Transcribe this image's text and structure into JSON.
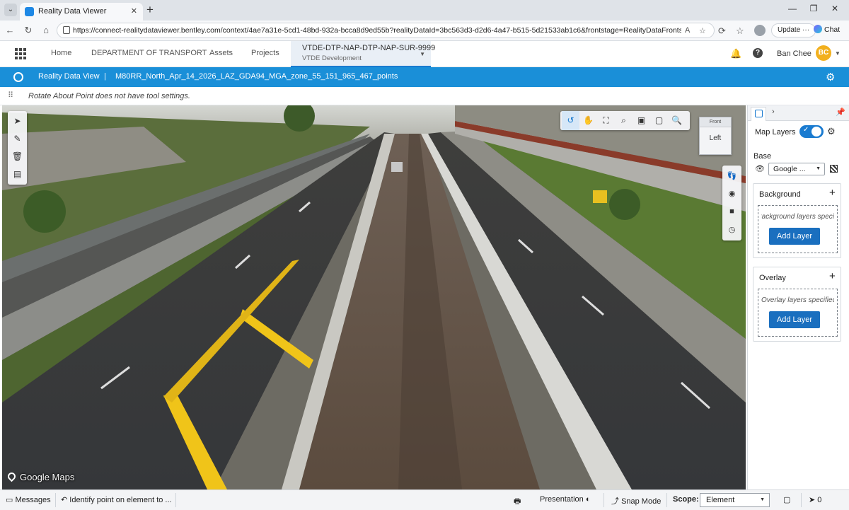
{
  "browser": {
    "tab_title": "Reality Data Viewer",
    "tab_close": "✕",
    "new_tab": "+",
    "url": "https://connect-realitydataviewer.bentley.com/context/4ae7a31e-5cd1-48bd-932a-bcca8d9ed55b?realityDataId=3bc563d3-d2d6-4a47-b515-5d21533ab1c6&frontstage=RealityDataFrontstage",
    "update_label": "Update",
    "chat_label": "Chat"
  },
  "app_header": {
    "nav": [
      "Home",
      "DEPARTMENT OF TRANSPORT",
      "Assets",
      "Projects"
    ],
    "project": {
      "name": "VTDE-DTP-NAP-DTP-NAP-SUR-9999",
      "subtitle": "VTDE Development"
    },
    "user_name": "Ban Chee",
    "user_initials": "BC"
  },
  "title_bar": {
    "view_name": "Reality Data View",
    "separator": "|",
    "dataset": "M80RR_North_Apr_14_2026_LAZ_GDA94_MGA_zone_55_151_965_467_points"
  },
  "tool_settings": {
    "message": "Rotate About Point does not have tool settings."
  },
  "viewport": {
    "nav_cube_face": "Left",
    "nav_cube_top": "Front",
    "attribution": "Google Maps"
  },
  "map_panel": {
    "map_layers_label": "Map Layers",
    "map_layers_on": true,
    "base_label": "Base",
    "base_value": "Google ...",
    "background": {
      "title": "Background",
      "hint": "Background layers specified",
      "add_label": "Add Layer"
    },
    "overlay": {
      "title": "Overlay",
      "hint": "Overlay layers specified",
      "add_label": "Add Layer"
    }
  },
  "status_bar": {
    "messages": "Messages",
    "identify": "Identify point on element to ...",
    "presentation": "Presentation",
    "snap_mode": "Snap Mode",
    "scope_label": "Scope:",
    "scope_value": "Element",
    "selection_count": "0"
  },
  "colors": {
    "accent": "#1a8fd8",
    "button": "#1a6fbf",
    "marking_yellow": "#f0c419"
  }
}
